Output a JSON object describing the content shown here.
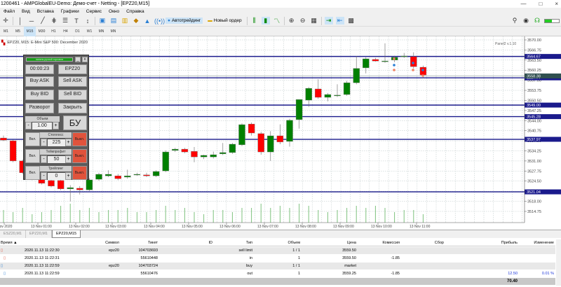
{
  "window": {
    "title": "1200461 - AMPGlobalEU-Demo: Демо-счет - Netting - [EPZ20,M15]",
    "minimize": "—",
    "maximize": "□",
    "close": "×"
  },
  "menu": [
    "Файл",
    "Вид",
    "Вставка",
    "Графики",
    "Сервис",
    "Окно",
    "Справка"
  ],
  "toolbar": {
    "autotrading": "Автотрейдинг",
    "new_order": "Новый ордер"
  },
  "timeframes": [
    "M1",
    "M5",
    "M15",
    "M30",
    "H1",
    "H4",
    "D1",
    "W1",
    "MN",
    "MN"
  ],
  "timeframe_active": "M15",
  "chart": {
    "title": "EPZ20, M15:  E-Mini S&P 500: December 2020",
    "indicator": "Panel2 v.1.10",
    "colors": {
      "bull": "#008000",
      "bear": "#ff0000",
      "level": "#1a1a8c"
    },
    "price_ticks": [
      "3570.00",
      "3566.75",
      "3563.50",
      "3560.25",
      "3557.00",
      "3553.75",
      "3550.50",
      "3547.25",
      "3544.00",
      "3540.75",
      "3537.50",
      "3534.25",
      "3531.00",
      "3527.75",
      "3524.50",
      "3521.25",
      "3518.00",
      "3514.75"
    ],
    "levels": [
      {
        "price": 3564.67,
        "label": "3564.67"
      },
      {
        "price": 3557.77,
        "label": "3557.77"
      },
      {
        "price": 3549.0,
        "label": "3549.00"
      },
      {
        "price": 3545.28,
        "label": "3545.28"
      },
      {
        "price": 3537.97,
        "label": "3537.97"
      },
      {
        "price": 3521.04,
        "label": "3521.04"
      }
    ],
    "current_price": {
      "price": 3558.38,
      "label": "3558.38"
    },
    "time_labels": [
      "Nov 2020",
      "13 Nov 01:00",
      "13 Nov 02:00",
      "13 Nov 03:00",
      "13 Nov 04:00",
      "13 Nov 05:00",
      "13 Nov 06:00",
      "13 Nov 07:00",
      "13 Nov 08:00",
      "13 Nov 09:00",
      "13 Nov 10:00",
      "13 Nov 11:00"
    ],
    "candles_ohlc": [
      [
        3538.4,
        3539.2,
        3537.4,
        3537.7
      ],
      [
        3537.5,
        3537.9,
        3530.6,
        3531.0
      ],
      [
        3531.0,
        3531.4,
        3526.8,
        3527.2
      ],
      [
        3527.2,
        3528,
        3524.8,
        3525.3
      ],
      [
        3526.0,
        3526.8,
        3523.4,
        3523.8
      ],
      [
        3524.7,
        3525.4,
        3522.5,
        3522.9
      ],
      [
        3524.7,
        3525.2,
        3521.6,
        3522.0
      ],
      [
        3522.0,
        3523.2,
        3517.9,
        3522.4
      ],
      [
        3522.2,
        3522.9,
        3520.2,
        3521.7
      ],
      [
        3521.7,
        3525.4,
        3521.3,
        3524.9
      ],
      [
        3525.1,
        3527.2,
        3524.6,
        3526.7
      ],
      [
        3526.2,
        3528.0,
        3525.8,
        3526.7
      ],
      [
        3526.2,
        3526.8,
        3524.8,
        3525.3
      ],
      [
        3525.8,
        3528.2,
        3525.3,
        3526.2
      ],
      [
        3526.7,
        3527.2,
        3526.2,
        3526.7
      ],
      [
        3526.5,
        3527.2,
        3525.8,
        3526.2
      ],
      [
        3526.2,
        3528.0,
        3525.8,
        3527.6
      ],
      [
        3527.8,
        3534.4,
        3527.4,
        3533.9
      ],
      [
        3534.4,
        3535.2,
        3533.9,
        3534.8
      ],
      [
        3534.8,
        3535.2,
        3533.5,
        3533.9
      ],
      [
        3534.1,
        3535.5,
        3530.6,
        3532.3
      ],
      [
        3532.3,
        3533.0,
        3531.6,
        3532.8
      ],
      [
        3532.3,
        3534.0,
        3531.8,
        3533.0
      ],
      [
        3533.3,
        3536.8,
        3532.9,
        3533.7
      ],
      [
        3533.7,
        3536.8,
        3533.3,
        3536.4
      ],
      [
        3536.2,
        3543.1,
        3535.8,
        3542.7
      ],
      [
        3542.9,
        3543.4,
        3539.2,
        3540.0
      ],
      [
        3539.8,
        3540.4,
        3533.0,
        3533.9
      ],
      [
        3533.9,
        3540.6,
        3531.0,
        3539.1
      ],
      [
        3539.1,
        3542.8,
        3536.4,
        3537.1
      ],
      [
        3537.3,
        3544.6,
        3535.6,
        3544.1
      ],
      [
        3544.3,
        3550.8,
        3541.4,
        3550.8
      ],
      [
        3550.6,
        3554.8,
        3548.4,
        3554.4
      ],
      [
        3554.2,
        3557.3,
        3551.0,
        3551.5
      ],
      [
        3551.5,
        3552.9,
        3550.2,
        3552.4
      ],
      [
        3552.2,
        3555.7,
        3551.6,
        3552.2
      ],
      [
        3552.4,
        3556.8,
        3552.0,
        3556.2
      ],
      [
        3556.2,
        3564.8,
        3555.7,
        3560.8
      ],
      [
        3561.0,
        3564.4,
        3559.2,
        3563.9
      ],
      [
        3563.7,
        3564.2,
        3563.0,
        3563.2
      ],
      [
        3563.0,
        3568.9,
        3562.6,
        3563.2
      ],
      [
        3563.5,
        3564.9,
        3562.8,
        3564.4
      ],
      [
        3564.8,
        3565.8,
        3564.2,
        3564.8
      ],
      [
        3564.6,
        3566.0,
        3560.8,
        3561.4
      ],
      [
        3561.2,
        3561.7,
        3557.6,
        3558.7
      ]
    ],
    "volumes": [
      6,
      5,
      7,
      4,
      5,
      6,
      8,
      9,
      6,
      7,
      5,
      6,
      6,
      7,
      5,
      5,
      6,
      8,
      6,
      7,
      5,
      4,
      6,
      6,
      5,
      7,
      7,
      9,
      7,
      8,
      7,
      9,
      8,
      6,
      5,
      6,
      7,
      8,
      7,
      8,
      7,
      5,
      6,
      6,
      4
    ]
  },
  "panel": {
    "title": "панель ручной торговли",
    "minimize": "_",
    "close": "x",
    "timer": "00:00:23",
    "symbol": "EPZ20",
    "buy_ask": "Buy ASK",
    "sell_ask": "Sell ASK",
    "buy_bid": "Buy BID",
    "sell_bid": "Sell BID",
    "reverse": "Разворот",
    "close_all": "Закрыть",
    "volume_label": "Объем",
    "volume": "1.00",
    "breakeven": "БУ",
    "minus": "-",
    "plus": "+",
    "stoploss": {
      "label": "Стоплосс",
      "value": "225",
      "on": "Вкл.",
      "off": "Выкл."
    },
    "takeprofit": {
      "label": "Тейкпрофит",
      "value": "50",
      "on": "Вкл.",
      "off": "Выкл."
    },
    "trailing": {
      "label": "Трейлинг",
      "value": "0",
      "on": "Вкл.",
      "off": "Выкл."
    }
  },
  "tabs": [
    "ESZ20,M1",
    "EPZ20,M1",
    "EPZ20,M15"
  ],
  "table": {
    "headers": {
      "time": "Время ▲",
      "symbol": "Символ",
      "ticket": "Тикет",
      "id": "ID",
      "type": "Тип",
      "volume": "Объем",
      "price": "Цена",
      "commission": "Комиссия",
      "fee": "Сбор",
      "profit": "Прибыль",
      "change": "Изменение"
    },
    "rows": [
      {
        "time": "2020.11.13 11:22:30",
        "symbol": "epz20",
        "ticket": "104703693",
        "id": "",
        "type": "sell limit",
        "volume": "1 / 1",
        "price": "3559.50",
        "commission": "",
        "fee": "",
        "profit": "",
        "change": ""
      },
      {
        "time": "2020.11.13 11:22:31",
        "symbol": "",
        "ticket": "55610448",
        "id": "",
        "type": "in",
        "volume": "1",
        "price": "3559.50",
        "commission": "-1.85",
        "fee": "",
        "profit": "",
        "change": ""
      },
      {
        "time": "2020.11.13 11:22:59",
        "symbol": "epz20",
        "ticket": "104703724",
        "id": "",
        "type": "buy",
        "volume": "1 / 1",
        "price": "market",
        "commission": "",
        "fee": "",
        "profit": "",
        "change": ""
      },
      {
        "time": "2020.11.13 11:22:59",
        "symbol": "",
        "ticket": "55610476",
        "id": "",
        "type": "out",
        "volume": "1",
        "price": "3559.25",
        "commission": "-1.85",
        "fee": "",
        "profit": "12.50",
        "change": "0.01 %"
      }
    ],
    "total_profit": "70.40"
  }
}
